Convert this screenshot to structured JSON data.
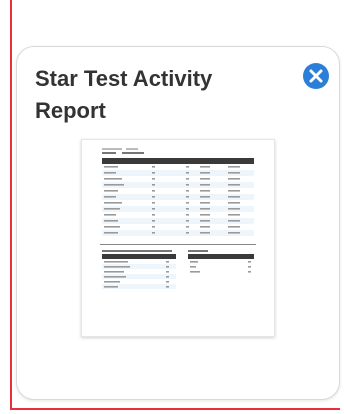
{
  "card": {
    "title": "Star Test Activity Report",
    "close_icon": "close-circle-icon",
    "accent_color": "#2b7fd6"
  }
}
